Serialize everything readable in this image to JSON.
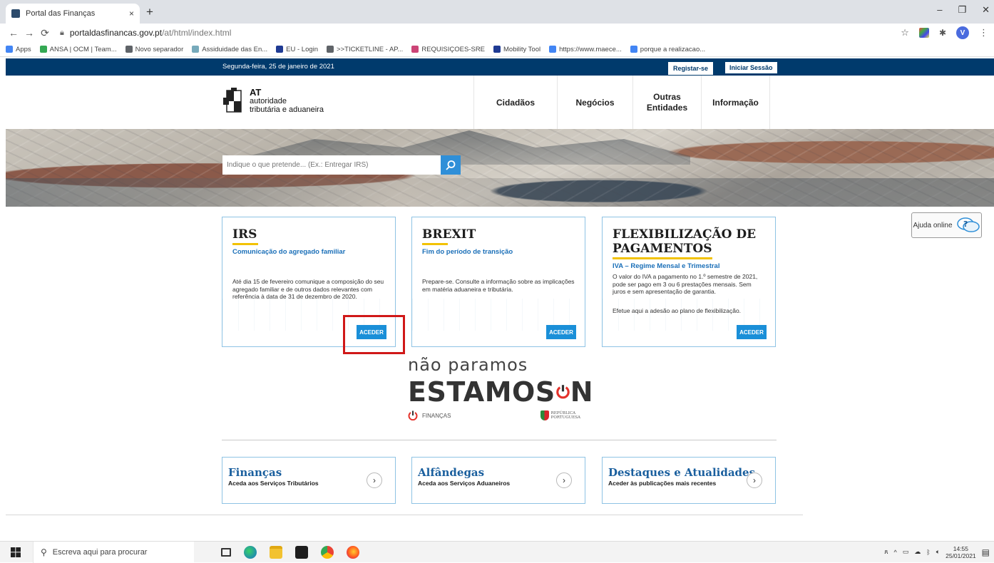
{
  "browser": {
    "tab_title": "Portal das Finanças",
    "tab_close": "×",
    "new_tab": "+",
    "url_host": "portaldasfinancas.gov.pt",
    "url_path": "/at/html/index.html",
    "profile_initial": "V",
    "window_controls": [
      "–",
      "❐",
      "✕"
    ],
    "bookmarks": [
      {
        "label": "Apps",
        "color": "#4285f4"
      },
      {
        "label": "ANSA | OCM | Team...",
        "color": "#34a853"
      },
      {
        "label": "Novo separador",
        "color": "#5f6368"
      },
      {
        "label": "Assiduidade das En...",
        "color": "#7ab"
      },
      {
        "label": "EU - Login",
        "color": "#1f3a93"
      },
      {
        "label": ">>TICKETLINE - AP...",
        "color": "#5f6368"
      },
      {
        "label": "REQUISIÇOES-SRE",
        "color": "#c47"
      },
      {
        "label": "Mobility Tool",
        "color": "#1f3a93"
      },
      {
        "label": "https://www.maece...",
        "color": "#4285f4"
      },
      {
        "label": "porque a realizacao...",
        "color": "#4285f4"
      }
    ]
  },
  "topstrip": {
    "date": "Segunda-feira, 25 de janeiro de 2021",
    "register": "Registar-se",
    "login": "Iniciar Sessão"
  },
  "header": {
    "logo_line1": "AT",
    "logo_line2": "autoridade",
    "logo_line3": "tributária e aduaneira",
    "nav": [
      "Cidadãos",
      "Negócios",
      "Outras Entidades",
      "Informação"
    ]
  },
  "search": {
    "placeholder": "Indique o que pretende... (Ex.: Entregar IRS)"
  },
  "cards": [
    {
      "title": "IRS",
      "subtitle": "Comunicação do agregado familiar",
      "text": "Até dia 15 de fevereiro comunique a composição do seu agregado familiar e de outros dados relevantes com referência à data de 31 de dezembro de 2020.",
      "button": "ACEDER"
    },
    {
      "title": "BREXIT",
      "subtitle": "Fim do período de transição",
      "text": "Prepare-se. Consulte a informação sobre as implicações em matéria aduaneira e tributária.",
      "button": "ACEDER"
    },
    {
      "title": "FLEXIBILIZAÇÃO DE PAGAMENTOS",
      "subtitle": "IVA – Regime Mensal e Trimestral",
      "text": "O valor do IVA a pagamento no 1.º semestre de 2021, pode ser pago em 3 ou 6 prestações mensais. Sem juros e sem apresentação de garantia.",
      "text2": "Efetue aqui a adesão ao plano de flexibilização.",
      "button": "ACEDER"
    }
  ],
  "help": {
    "label": "Ajuda online"
  },
  "campaign": {
    "line1": "não paramos",
    "line2a": "ESTAMOS ",
    "line2b": "N",
    "financas": "FINANÇAS",
    "republica1": "REPÚBLICA",
    "republica2": "PORTUGUESA"
  },
  "links": [
    {
      "title": "Finanças",
      "subtitle": "Aceda aos Serviços Tributários"
    },
    {
      "title": "Alfândegas",
      "subtitle": "Aceda aos Serviços Aduaneiros"
    },
    {
      "title": "Destaques e Atualidades",
      "subtitle": "Aceder às publicações mais recentes"
    }
  ],
  "taskbar": {
    "search_placeholder": "Escreva aqui para procurar",
    "time": "14:55",
    "date": "25/01/2021"
  }
}
